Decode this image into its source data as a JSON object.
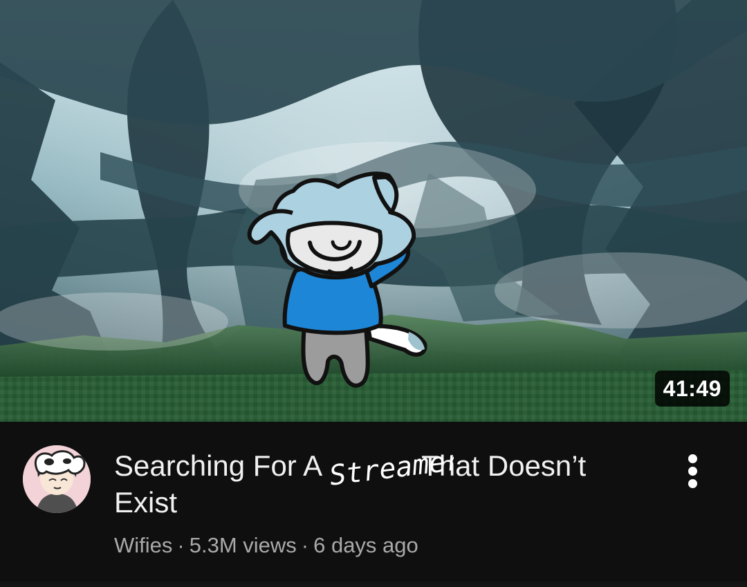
{
  "video": {
    "duration": "41:49",
    "title_start": "Searching For A",
    "handwritten_word": "Streamer",
    "title_end": "That Doesn’t Exist",
    "channel": "Wifies",
    "separator": "·",
    "views": "5.3M views",
    "published": "6 days ago"
  },
  "icons": {
    "menu": "more-vert-icon"
  },
  "colors": {
    "background": "#0f0f0f",
    "title": "#f1f1f1",
    "metadata": "#aaaaaa",
    "badge_background": "#000000"
  }
}
